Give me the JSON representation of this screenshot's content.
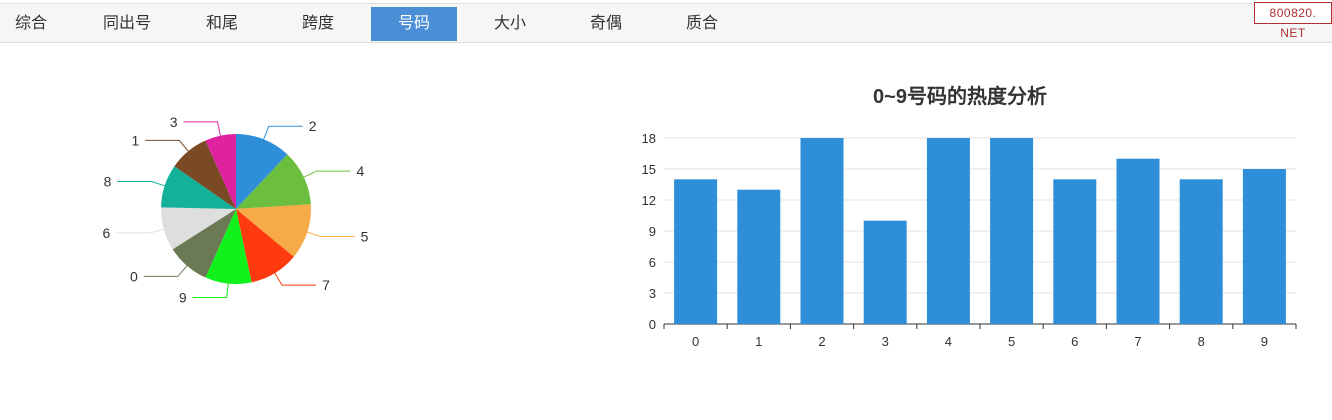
{
  "tabs": [
    {
      "label": "综合",
      "active": false
    },
    {
      "label": "同出号",
      "active": false
    },
    {
      "label": "和尾",
      "active": false
    },
    {
      "label": "跨度",
      "active": false
    },
    {
      "label": "号码",
      "active": true
    },
    {
      "label": "大小",
      "active": false
    },
    {
      "label": "奇偶",
      "active": false
    },
    {
      "label": "质合",
      "active": false
    }
  ],
  "watermark": "800820. NET",
  "chart_data": [
    {
      "type": "pie",
      "title": "",
      "slices": [
        {
          "label": "2",
          "value": 18,
          "color": "#2e8fd8"
        },
        {
          "label": "4",
          "value": 18,
          "color": "#6cbf3e"
        },
        {
          "label": "5",
          "value": 18,
          "color": "#f7aa48"
        },
        {
          "label": "7",
          "value": 16,
          "color": "#ff3a0f"
        },
        {
          "label": "9",
          "value": 15,
          "color": "#11f21c"
        },
        {
          "label": "0",
          "value": 14,
          "color": "#6b7a55"
        },
        {
          "label": "6",
          "value": 14,
          "color": "#dedede"
        },
        {
          "label": "8",
          "value": 14,
          "color": "#13b199"
        },
        {
          "label": "1",
          "value": 13,
          "color": "#7a4a25"
        },
        {
          "label": "3",
          "value": 10,
          "color": "#df22a0"
        }
      ]
    },
    {
      "type": "bar",
      "title": "0~9号码的热度分析",
      "categories": [
        "0",
        "1",
        "2",
        "3",
        "4",
        "5",
        "6",
        "7",
        "8",
        "9"
      ],
      "values": [
        14,
        13,
        18,
        10,
        18,
        18,
        14,
        16,
        14,
        15
      ],
      "yticks": [
        0,
        3,
        6,
        9,
        12,
        15,
        18
      ],
      "ylim": [
        0,
        18
      ],
      "grid": true,
      "bar_color": "#2e8fd8"
    }
  ]
}
